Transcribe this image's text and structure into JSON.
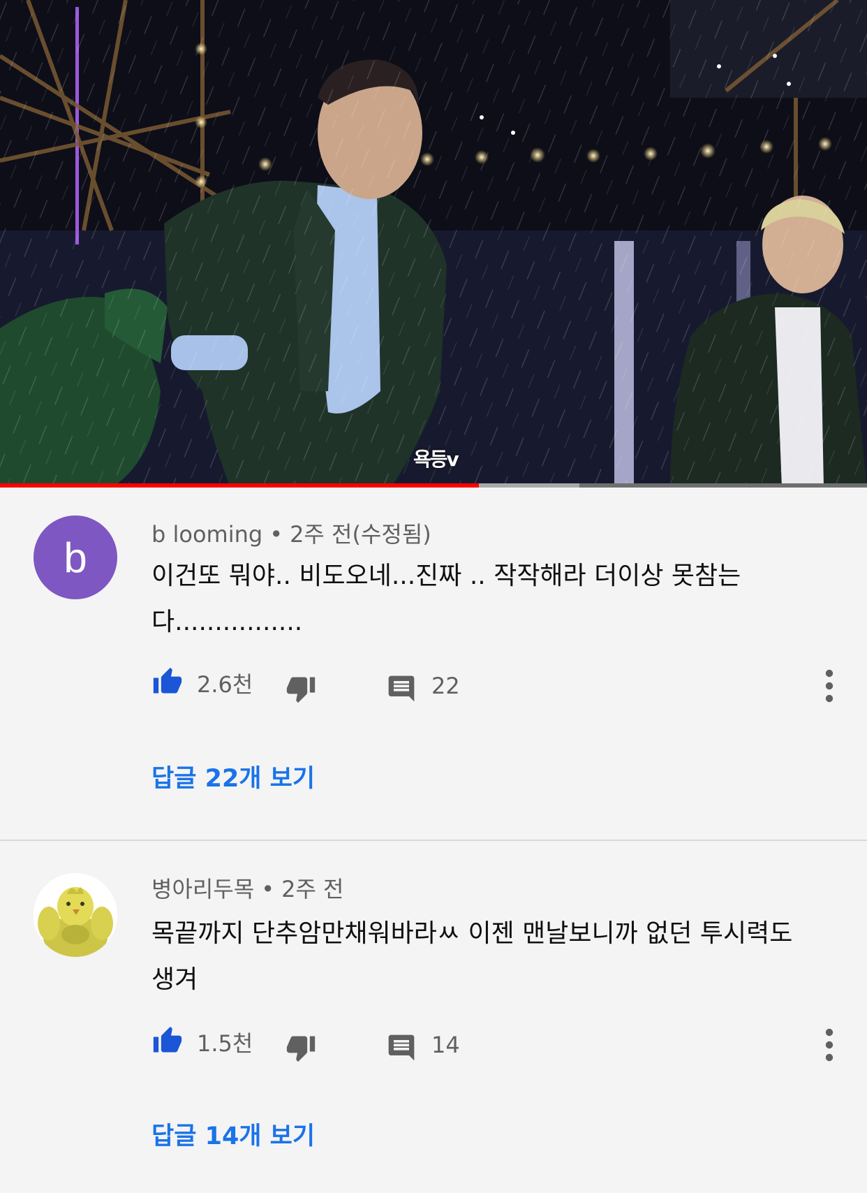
{
  "video": {
    "watermark": "욕등v",
    "progress_played": 0.552,
    "progress_buffered": 0.668
  },
  "comments": [
    {
      "avatar_letter": "b",
      "author": "b looming",
      "separator": "•",
      "time": "2주 전(수정됨)",
      "text": "이건또 뭐야.. 비도오네...진짜 .. 작작해라 더이상 못참는다................",
      "likes": "2.6천",
      "reply_count": "22",
      "view_replies": "답글 22개 보기",
      "icons": [
        "thumb-up-icon",
        "thumb-down-icon",
        "comment-icon",
        "more-vert-icon"
      ]
    },
    {
      "avatar_letter": "",
      "author": "병아리두목",
      "separator": "•",
      "time": "2주 전",
      "text": "목끝까지 단추암만채워바라ㅆ 이젠 맨날보니까 없던 투시력도 생겨",
      "likes": "1.5천",
      "reply_count": "14",
      "view_replies": "답글 14개 보기",
      "icons": [
        "thumb-up-icon",
        "thumb-down-icon",
        "comment-icon",
        "more-vert-icon"
      ]
    }
  ],
  "colors": {
    "accent": "#1a73e8",
    "progress": "#ff0000",
    "avatar_b": "#7e57c2",
    "background": "#f4f4f4"
  }
}
